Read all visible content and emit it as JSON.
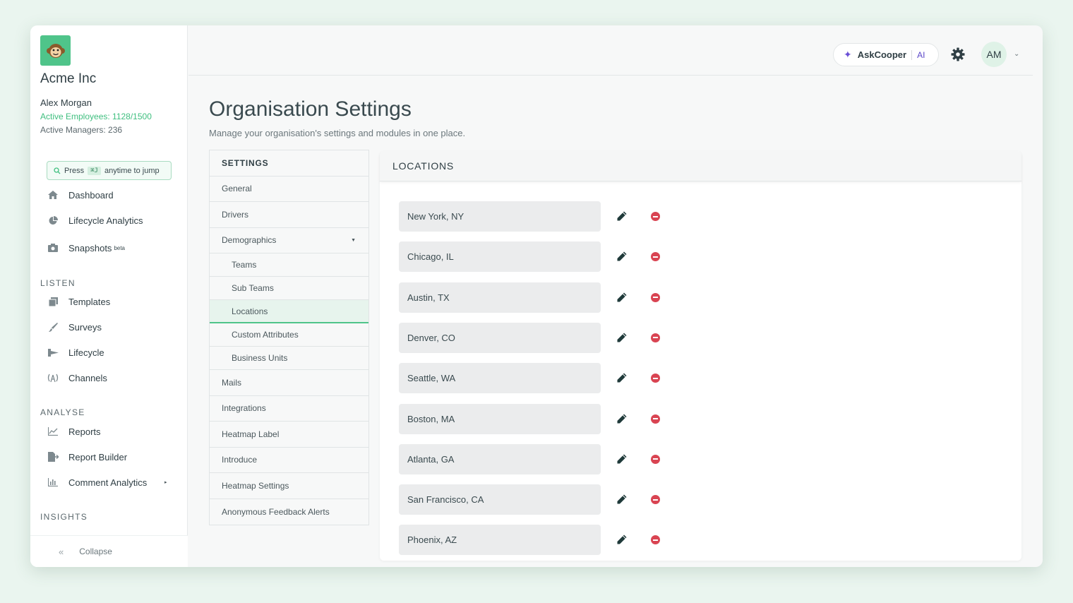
{
  "sidebar": {
    "company": "Acme Inc",
    "user_name": "Alex Morgan",
    "active_employees": "Active Employees: 1128/1500",
    "active_managers": "Active Managers: 236",
    "jump": {
      "press": "Press",
      "shortcut": "⌘J",
      "rest": "anytime to jump"
    },
    "main_items": [
      {
        "label": "Dashboard",
        "icon": "home-icon"
      },
      {
        "label": "Lifecycle Analytics",
        "icon": "pie-chart-icon"
      },
      {
        "label": "Snapshots",
        "badge": "beta",
        "icon": "camera-icon"
      }
    ],
    "listen_label": "LISTEN",
    "listen_items": [
      {
        "label": "Templates",
        "icon": "copy-icon"
      },
      {
        "label": "Surveys",
        "icon": "brush-icon"
      },
      {
        "label": "Lifecycle",
        "icon": "lifecycle-icon"
      },
      {
        "label": "Channels",
        "icon": "broadcast-icon"
      }
    ],
    "analyse_label": "ANALYSE",
    "analyse_items": [
      {
        "label": "Reports",
        "icon": "line-chart-icon"
      },
      {
        "label": "Report Builder",
        "icon": "file-export-icon"
      },
      {
        "label": "Comment Analytics",
        "icon": "bar-chart-icon"
      }
    ],
    "insights_label": "INSIGHTS",
    "collapse_label": "Collapse"
  },
  "topbar": {
    "ask_label": "AskCooper",
    "ask_ai": "AI",
    "avatar_initials": "AM"
  },
  "page": {
    "title": "Organisation Settings",
    "subtitle": "Manage your organisation's settings and modules in one place."
  },
  "settings_menu": {
    "header": "SETTINGS",
    "items": [
      "General",
      "Drivers",
      "Demographics",
      "Teams",
      "Sub Teams",
      "Locations",
      "Custom Attributes",
      "Business Units",
      "Mails",
      "Integrations",
      "Heatmap Label",
      "Introduce",
      "Heatmap Settings",
      "Anonymous Feedback Alerts"
    ]
  },
  "locations": {
    "header": "LOCATIONS",
    "items": [
      "New York, NY",
      "Chicago, IL",
      "Austin, TX",
      "Denver, CO",
      "Seattle, WA",
      "Boston, MA",
      "Atlanta, GA",
      "San Francisco, CA",
      "Phoenix, AZ"
    ]
  },
  "colors": {
    "accent": "#4fc48a",
    "danger": "#d94452",
    "ai": "#5a46c8"
  }
}
